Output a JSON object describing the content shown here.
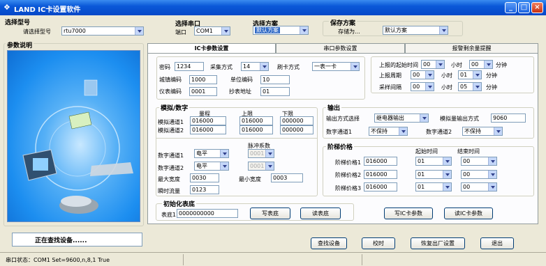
{
  "app": {
    "title": "LAND  IC卡设置软件"
  },
  "model": {
    "heading": "选择型号",
    "label": "请选择型号",
    "value": "rtu7000"
  },
  "serial": {
    "heading": "选择串口",
    "label": "端口",
    "value": "COM1"
  },
  "scheme": {
    "heading": "选择方案",
    "value": "默认方案",
    "save_heading": "保存方案",
    "save_button": "存储为...",
    "save_value": "默认方案"
  },
  "left": {
    "heading": "参数说明",
    "status": "正在查找设备......"
  },
  "tabs": [
    "IC卡参数设置",
    "串口参数设置",
    "报警剩余量提醒"
  ],
  "basic": {
    "password_label": "密码",
    "password": "1234",
    "collect_label": "采集方式",
    "collect": "14",
    "swipe_label": "刷卡方式",
    "swipe": "一表一卡",
    "city_label": "城镇编码",
    "city": "1000",
    "unit_label": "单位编码",
    "unit": "10",
    "meter_label": "仪表编码",
    "meter": "0001",
    "addr_label": "抄表地址",
    "addr": "01"
  },
  "report": {
    "start_label": "上报的起始时间",
    "start_h": "00",
    "start_m": "00",
    "period_label": "上报周期",
    "period_h": "00",
    "period_m": "01",
    "sample_label": "采样间隔",
    "sample_h": "00",
    "sample_m": "05",
    "hour": "小时",
    "minute": "分钟"
  },
  "analog": {
    "heading": "模拟/数字",
    "col_range": "量程",
    "col_upper": "上限",
    "col_lower": "下限",
    "ch1_label": "模拟通道1",
    "ch1": [
      "016000",
      "016000",
      "000000"
    ],
    "ch2_label": "模拟通道2",
    "ch2": [
      "016000",
      "016000",
      "000000"
    ]
  },
  "digital": {
    "pulse_heading": "脉冲系数",
    "d1_label": "数字通道1",
    "d1": "电平",
    "d1_pulse": "0001",
    "d2_label": "数字通道2",
    "d2": "电平",
    "d2_pulse": "0001",
    "max_label": "最大宽度",
    "max": "0030",
    "min_label": "最小宽度",
    "min": "0003",
    "flow_label": "瞬时流量",
    "flow": "0123"
  },
  "output": {
    "heading": "输出",
    "mode_label": "输出方式选择",
    "mode": "继电器输出",
    "analog_label": "模拟量输出方式",
    "analog": "9060",
    "dig1_label": "数字通道1",
    "dig1": "不保持",
    "dig2_label": "数字通道2",
    "dig2": "不保持"
  },
  "price": {
    "heading": "阶梯价格",
    "start_col": "起始时间",
    "end_col": "结束时间",
    "rows": [
      {
        "label": "阶梯价格1",
        "value": "016000",
        "start": "01",
        "end": "00"
      },
      {
        "label": "阶梯价格2",
        "value": "016000",
        "start": "01",
        "end": "00"
      },
      {
        "label": "阶梯价格3",
        "value": "016000",
        "start": "01",
        "end": "00"
      }
    ]
  },
  "init": {
    "heading": "初始化表底",
    "label": "表底1",
    "value": "0000000000",
    "write_button": "写表底",
    "read_button": "读表底",
    "write_card": "写IC卡参数",
    "read_card": "读IC卡参数"
  },
  "actions": {
    "find": "查找设备",
    "sync": "校时",
    "reset": "恢复出厂设置",
    "exit": "退出"
  },
  "status": {
    "text": "串口状态：COM1  Set=9600,n,8,1 True"
  },
  "colors": {
    "titlebar": "#0a58d8",
    "panel_blue": "#1c8ef0",
    "selection": "#316ac5"
  }
}
